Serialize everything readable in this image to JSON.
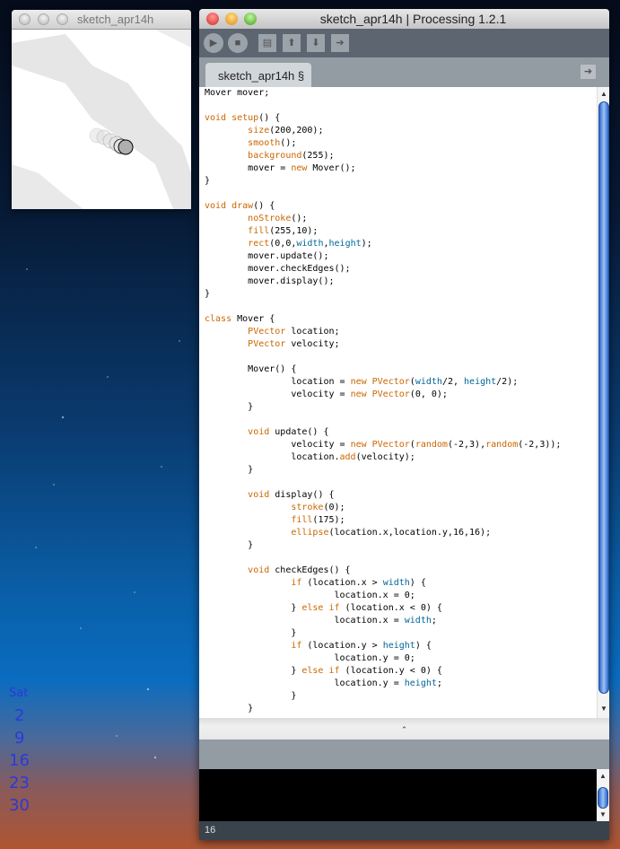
{
  "sketch_window": {
    "title": "sketch_apr14h"
  },
  "ide": {
    "title": "sketch_apr14h | Processing 1.2.1",
    "toolbar": {
      "run": "▶",
      "stop": "■",
      "new": "▤",
      "open": "⬆",
      "save": "⬇",
      "export": "➔"
    },
    "tab_label": "sketch_apr14h §",
    "tab_arrow": "➔",
    "status_line": "16"
  },
  "colors": {
    "keyword": "#cc6600",
    "constant": "#006699"
  },
  "code": {
    "lines": [
      [
        [
          "Mover mover;",
          ""
        ]
      ],
      [],
      [
        [
          "void setup",
          "k"
        ],
        [
          "() {",
          ""
        ]
      ],
      [
        [
          "        ",
          ""
        ],
        [
          "size",
          "k"
        ],
        [
          "(200,200);",
          ""
        ]
      ],
      [
        [
          "        ",
          ""
        ],
        [
          "smooth",
          "k"
        ],
        [
          "();",
          ""
        ]
      ],
      [
        [
          "        ",
          ""
        ],
        [
          "background",
          "k"
        ],
        [
          "(255);",
          ""
        ]
      ],
      [
        [
          "        mover = ",
          ""
        ],
        [
          "new",
          "k"
        ],
        [
          " Mover();",
          ""
        ]
      ],
      [
        [
          "}",
          ""
        ]
      ],
      [],
      [
        [
          "void draw",
          "k"
        ],
        [
          "() {",
          ""
        ]
      ],
      [
        [
          "        ",
          ""
        ],
        [
          "noStroke",
          "k"
        ],
        [
          "();",
          ""
        ]
      ],
      [
        [
          "        ",
          ""
        ],
        [
          "fill",
          "k"
        ],
        [
          "(255,10);",
          ""
        ]
      ],
      [
        [
          "        ",
          ""
        ],
        [
          "rect",
          "k"
        ],
        [
          "(0,0,",
          ""
        ],
        [
          "width",
          "c"
        ],
        [
          ",",
          ""
        ],
        [
          "height",
          "c"
        ],
        [
          ");",
          ""
        ]
      ],
      [
        [
          "        mover.update();",
          ""
        ]
      ],
      [
        [
          "        mover.checkEdges();",
          ""
        ]
      ],
      [
        [
          "        mover.display();",
          ""
        ]
      ],
      [
        [
          "}",
          ""
        ]
      ],
      [],
      [
        [
          "class",
          "k"
        ],
        [
          " Mover {",
          ""
        ]
      ],
      [
        [
          "        ",
          ""
        ],
        [
          "PVector",
          "k"
        ],
        [
          " location;",
          ""
        ]
      ],
      [
        [
          "        ",
          ""
        ],
        [
          "PVector",
          "k"
        ],
        [
          " velocity;",
          ""
        ]
      ],
      [],
      [
        [
          "        Mover() {",
          ""
        ]
      ],
      [
        [
          "                location = ",
          ""
        ],
        [
          "new PVector",
          "k"
        ],
        [
          "(",
          ""
        ],
        [
          "width",
          "c"
        ],
        [
          "/2, ",
          ""
        ],
        [
          "height",
          "c"
        ],
        [
          "/2);",
          ""
        ]
      ],
      [
        [
          "                velocity = ",
          ""
        ],
        [
          "new PVector",
          "k"
        ],
        [
          "(0, 0);",
          ""
        ]
      ],
      [
        [
          "        }",
          ""
        ]
      ],
      [],
      [
        [
          "        ",
          ""
        ],
        [
          "void",
          "k"
        ],
        [
          " update() {",
          ""
        ]
      ],
      [
        [
          "                velocity = ",
          ""
        ],
        [
          "new PVector",
          "k"
        ],
        [
          "(",
          ""
        ],
        [
          "random",
          "k"
        ],
        [
          "(-2,3),",
          ""
        ],
        [
          "random",
          "k"
        ],
        [
          "(-2,3));",
          ""
        ]
      ],
      [
        [
          "                location.",
          ""
        ],
        [
          "add",
          "k"
        ],
        [
          "(velocity);",
          ""
        ]
      ],
      [
        [
          "        }",
          ""
        ]
      ],
      [],
      [
        [
          "        ",
          ""
        ],
        [
          "void",
          "k"
        ],
        [
          " display() {",
          ""
        ]
      ],
      [
        [
          "                ",
          ""
        ],
        [
          "stroke",
          "k"
        ],
        [
          "(0);",
          ""
        ]
      ],
      [
        [
          "                ",
          ""
        ],
        [
          "fill",
          "k"
        ],
        [
          "(175);",
          ""
        ]
      ],
      [
        [
          "                ",
          ""
        ],
        [
          "ellipse",
          "k"
        ],
        [
          "(location.x,location.y,16,16);",
          ""
        ]
      ],
      [
        [
          "        }",
          ""
        ]
      ],
      [],
      [
        [
          "        ",
          ""
        ],
        [
          "void",
          "k"
        ],
        [
          " checkEdges() {",
          ""
        ]
      ],
      [
        [
          "                ",
          ""
        ],
        [
          "if",
          "k"
        ],
        [
          " (location.x > ",
          ""
        ],
        [
          "width",
          "c"
        ],
        [
          ") {",
          ""
        ]
      ],
      [
        [
          "                        location.x = 0;",
          ""
        ]
      ],
      [
        [
          "                } ",
          ""
        ],
        [
          "else if",
          "k"
        ],
        [
          " (location.x < 0) {",
          ""
        ]
      ],
      [
        [
          "                        location.x = ",
          ""
        ],
        [
          "width",
          "c"
        ],
        [
          ";",
          ""
        ]
      ],
      [
        [
          "                }",
          ""
        ]
      ],
      [
        [
          "                ",
          ""
        ],
        [
          "if",
          "k"
        ],
        [
          " (location.y > ",
          ""
        ],
        [
          "height",
          "c"
        ],
        [
          ") {",
          ""
        ]
      ],
      [
        [
          "                        location.y = 0;",
          ""
        ]
      ],
      [
        [
          "                } ",
          ""
        ],
        [
          "else if",
          "k"
        ],
        [
          " (location.y < 0) {",
          ""
        ]
      ],
      [
        [
          "                        location.y = ",
          ""
        ],
        [
          "height",
          "c"
        ],
        [
          ";",
          ""
        ]
      ],
      [
        [
          "                }",
          ""
        ]
      ],
      [
        [
          "        }",
          ""
        ]
      ]
    ]
  },
  "calendar": {
    "day": "Sat",
    "dates": [
      "2",
      "9",
      "16",
      "23",
      "30"
    ]
  }
}
